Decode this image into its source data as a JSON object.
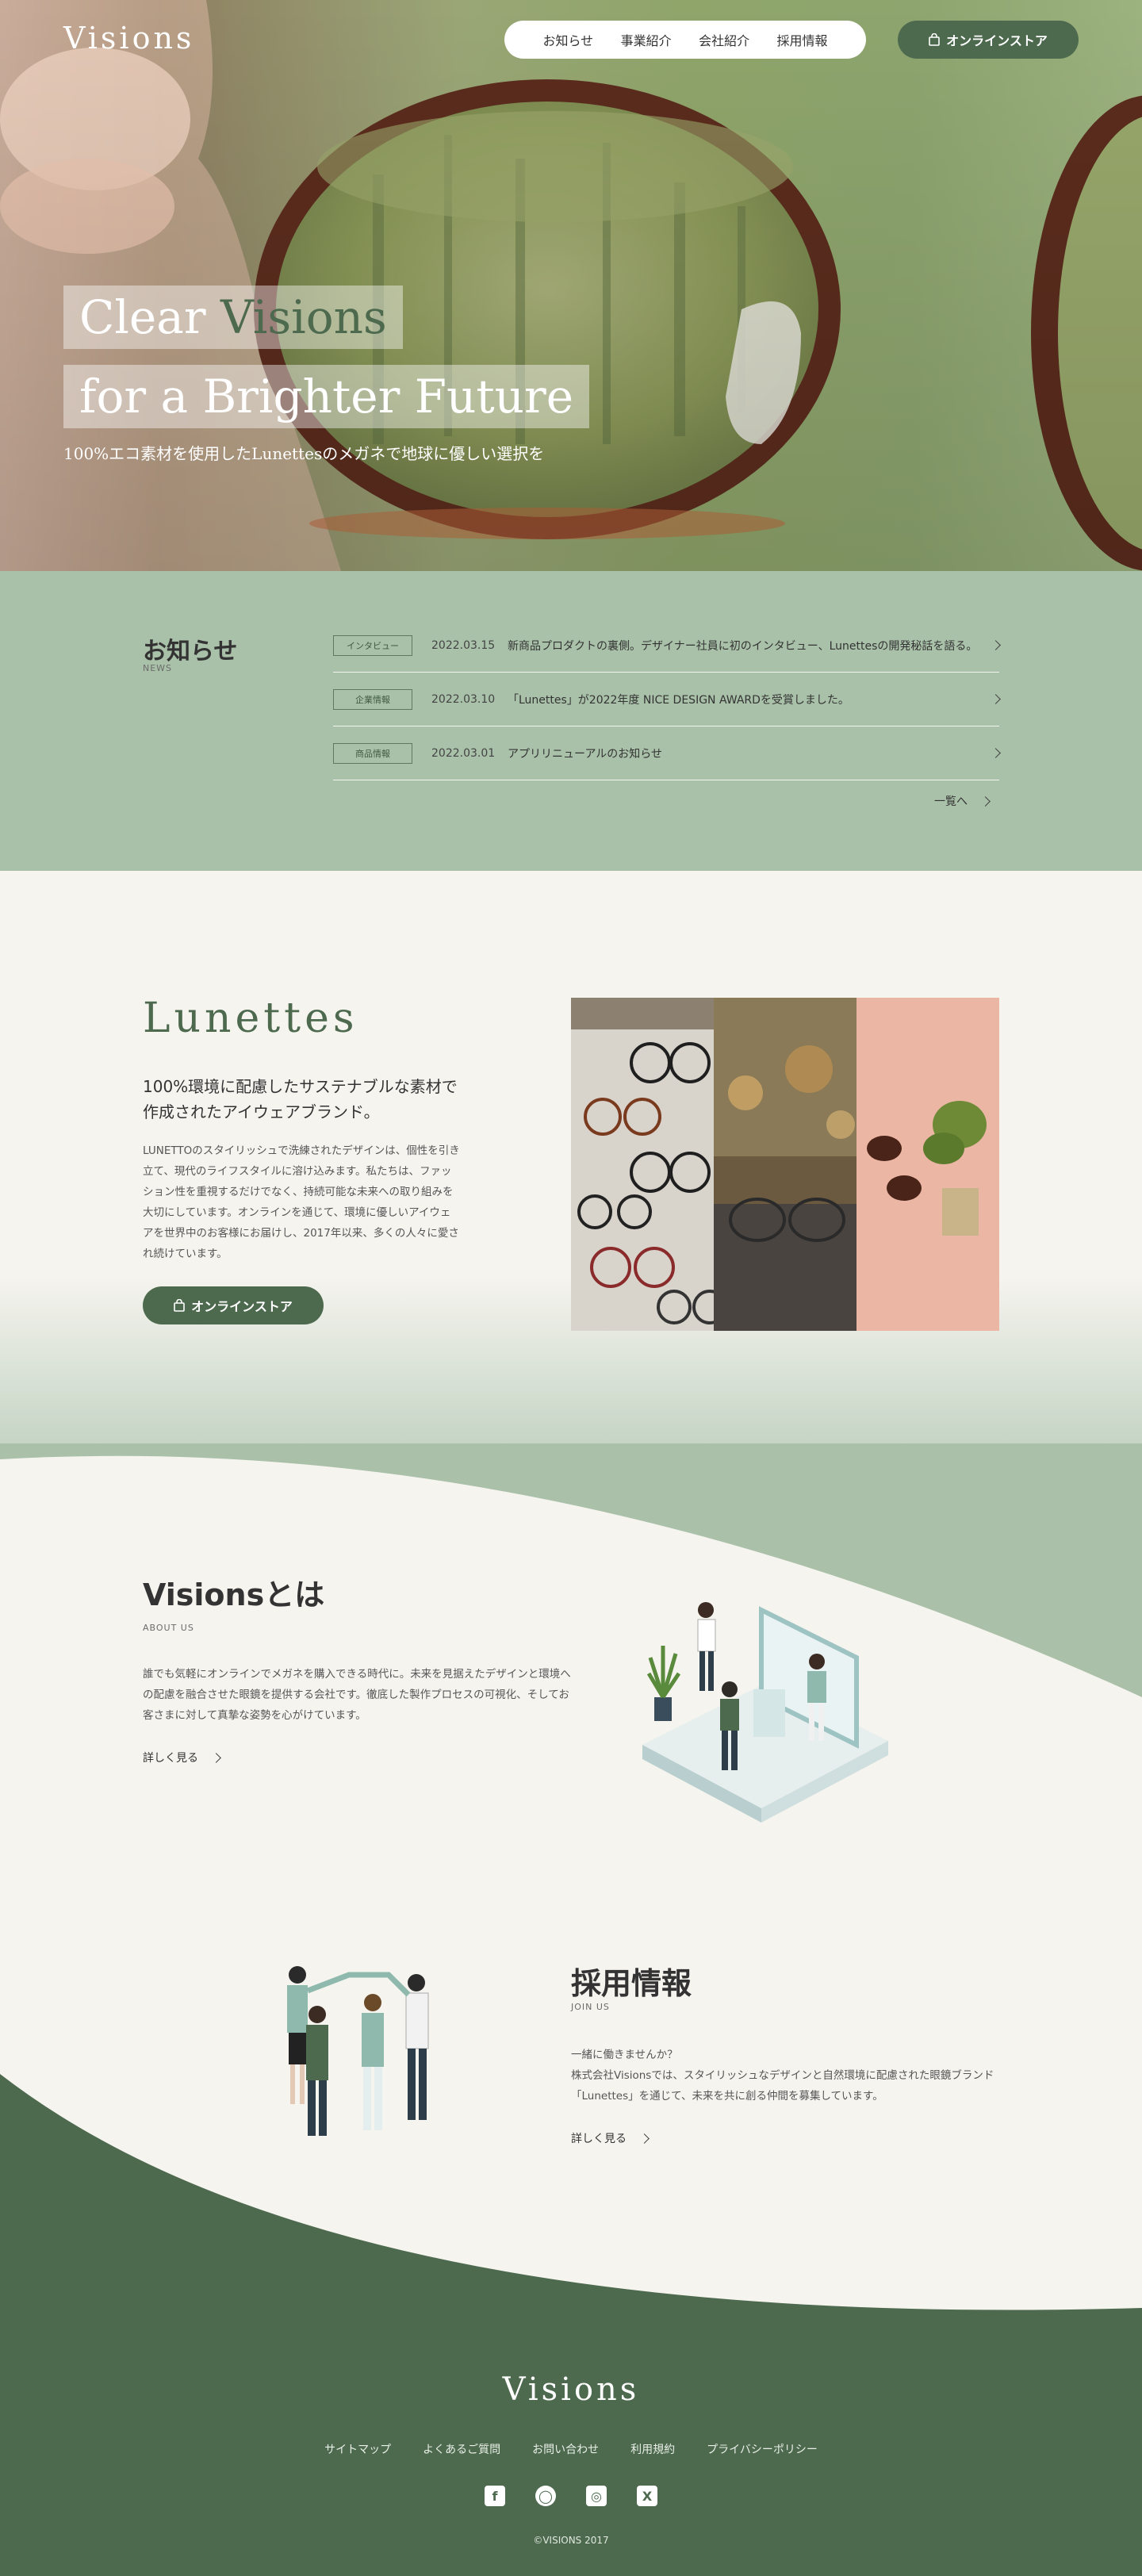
{
  "header": {
    "logo": "Visions",
    "nav": [
      "お知らせ",
      "事業紹介",
      "会社紹介",
      "採用情報"
    ],
    "store_button": "オンラインストア"
  },
  "hero": {
    "line1_a": "Clear ",
    "line1_b": "Visions",
    "line2": "for a Brighter Future",
    "subtitle": "100%エコ素材を使用したLunettesのメガネで地球に優しい選択を"
  },
  "news": {
    "title": "お知らせ",
    "title_en": "NEWS",
    "items": [
      {
        "tag": "インタビュー",
        "date": "2022.03.15",
        "text": "新商品プロダクトの裏側。デザイナー社員に初のインタビュー、Lunettesの開発秘話を語る。"
      },
      {
        "tag": "企業情報",
        "date": "2022.03.10",
        "text": "「Lunettes」が2022年度 NICE DESIGN AWARDを受賞しました。"
      },
      {
        "tag": "商品情報",
        "date": "2022.03.01",
        "text": "アプリリニューアルのお知らせ"
      }
    ],
    "more": "一覧へ"
  },
  "lunettes": {
    "title": "Lunettes",
    "lead_1": "100%環境に配慮したサステナブルな素材で",
    "lead_2": "作成されたアイウェアブランド。",
    "body": "LUNETTOのスタイリッシュで洗練されたデザインは、個性を引き立て、現代のライフスタイルに溶け込みます。私たちは、ファッション性を重視するだけでなく、持続可能な未来への取り組みを大切にしています。オンラインを通じて、環境に優しいアイウェアを世界中のお客様にお届けし、2017年以来、多くの人々に愛され続けています。",
    "store_button": "オンラインストア"
  },
  "about": {
    "title": "Visionsとは",
    "title_en": "ABOUT US",
    "body": "誰でも気軽にオンラインでメガネを購入できる時代に。未来を見据えたデザインと環境への配慮を融合させた眼鏡を提供する会社です。徹底した製作プロセスの可視化、そしてお客さまに対して真摯な姿勢を心がけています。",
    "more": "詳しく見る"
  },
  "recruit": {
    "title": "採用情報",
    "title_en": "JOIN US",
    "body_1": "一緒に働きませんか？",
    "body_2": "株式会社Visionsでは、スタイリッシュなデザインと自然環境に配慮された眼鏡ブランド「Lunettes」を通じて、未来を共に創る仲間を募集しています。",
    "more": "詳しく見る"
  },
  "footer": {
    "logo": "Visions",
    "links": [
      "サイトマップ",
      "よくあるご質問",
      "お問い合わせ",
      "利用規約",
      "プライバシーポリシー"
    ],
    "copyright": "©VISIONS 2017"
  },
  "colors": {
    "primary": "#4d6a4f",
    "sage": "#a9c1a9",
    "cream": "#f6f4ef"
  },
  "icons": [
    "bag-icon",
    "chevron-right-icon",
    "facebook-icon",
    "line-icon",
    "instagram-icon",
    "x-icon"
  ]
}
